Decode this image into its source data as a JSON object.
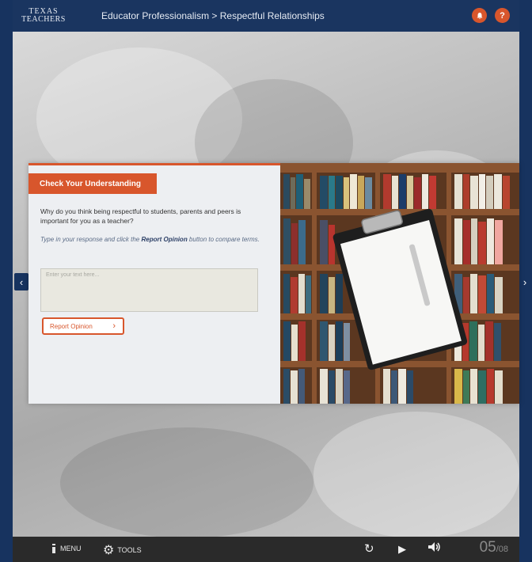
{
  "header": {
    "logo_line1": "TEXAS",
    "logo_line2": "TEACHERS",
    "breadcrumb": "Educator Professionalism > Respectful Relationships",
    "alert_icon": "bell-icon",
    "help_label": "?"
  },
  "card": {
    "heading": "Check Your Understanding",
    "question": "Why do you think being respectful to students, parents and peers is important for you as a teacher?",
    "instruction_pre": "Type in your response and click the ",
    "instruction_bold": "Report Opinion",
    "instruction_post": " button to compare terms.",
    "input_placeholder": "Enter your text here...",
    "submit_label": "Report Opinion"
  },
  "footer": {
    "menu_label": "MENU",
    "tools_label": "TOOLS",
    "page_current": "05",
    "page_total": "/08"
  },
  "colors": {
    "accent": "#d8562c",
    "navy": "#17335f",
    "bar": "#2a2a2a"
  }
}
